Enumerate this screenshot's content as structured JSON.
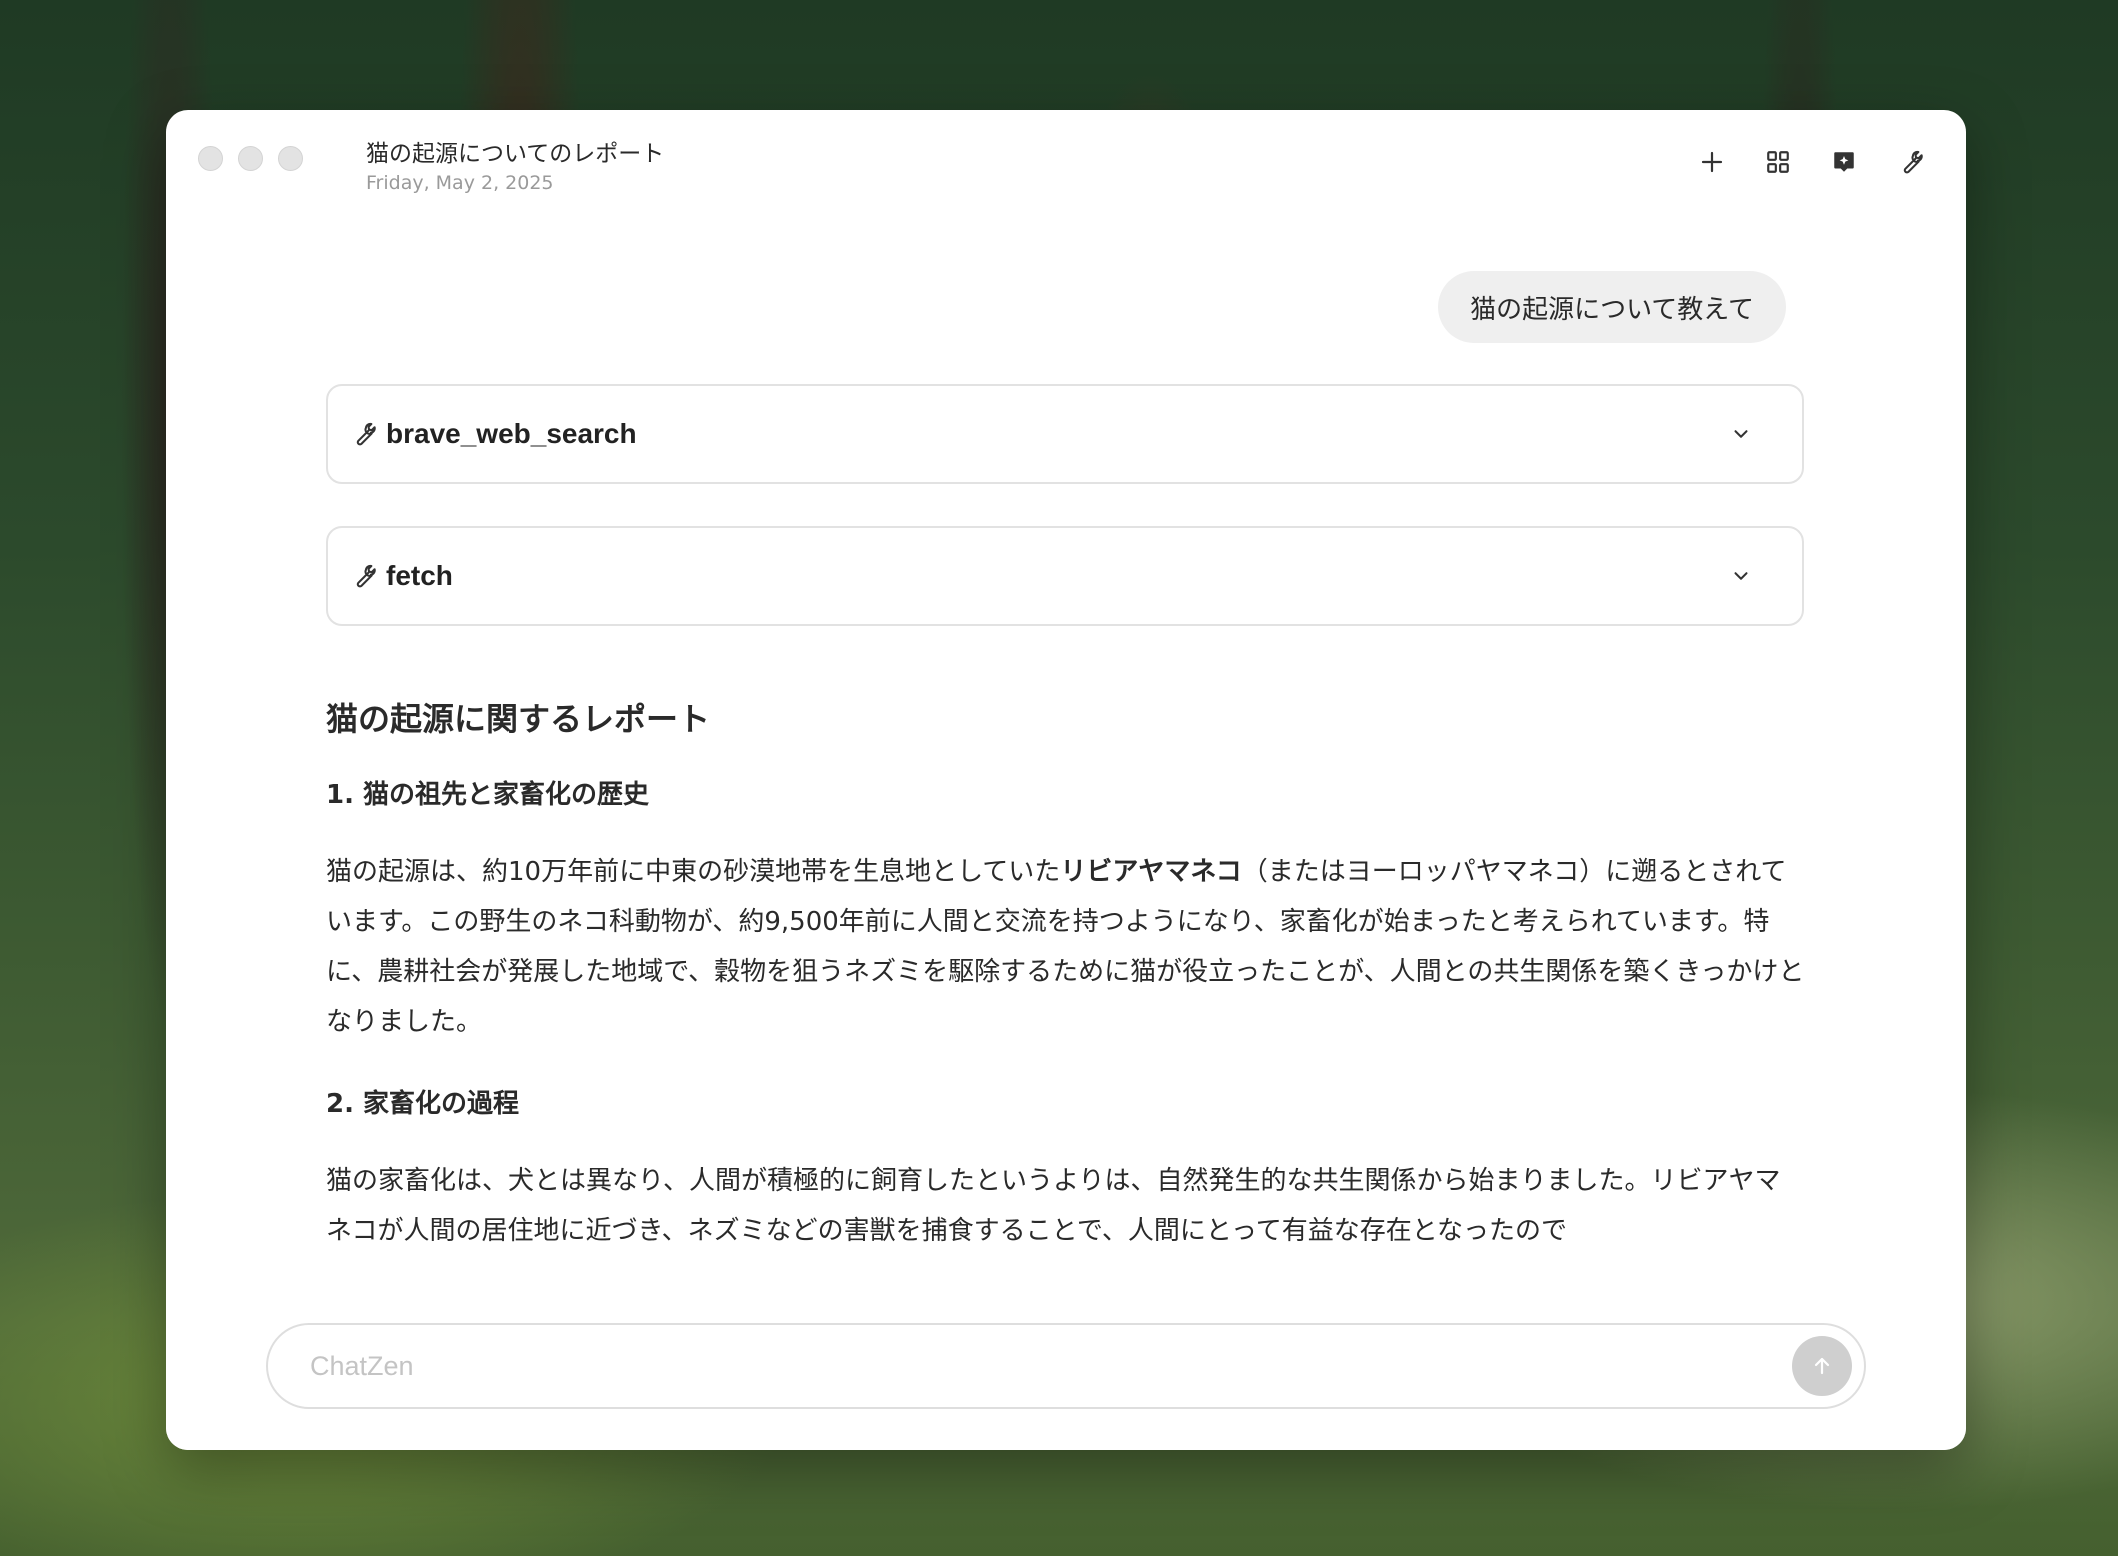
{
  "window": {
    "title": "猫の起源についてのレポート",
    "date": "Friday, May 2, 2025"
  },
  "toolbar": {
    "icons": [
      "plus-icon",
      "grid-icon",
      "sparkle-note-icon",
      "wrench-icon"
    ]
  },
  "chat": {
    "user_message": "猫の起源について教えて",
    "tool_calls": [
      {
        "name": "brave_web_search",
        "icon": "wrench-icon"
      },
      {
        "name": "fetch",
        "icon": "wrench-icon"
      }
    ],
    "report": {
      "title": "猫の起源に関するレポート",
      "section1_heading": "1. 猫の祖先と家畜化の歴史",
      "section1_p_before": "猫の起源は、約10万年前に中東の砂漠地帯を生息地としていた",
      "section1_p_bold": "リビアヤマネコ",
      "section1_p_after": "（またはヨーロッパヤマネコ）に遡るとされています。この野生のネコ科動物が、約9,500年前に人間と交流を持つようになり、家畜化が始まったと考えられています。特に、農耕社会が発展した地域で、穀物を狙うネズミを駆除するために猫が役立ったことが、人間との共生関係を築くきっかけとなりました。",
      "section2_heading": "2. 家畜化の過程",
      "section2_p": "猫の家畜化は、犬とは異なり、人間が積極的に飼育したというよりは、自然発生的な共生関係から始まりました。リビアヤマネコが人間の居住地に近づき、ネズミなどの害獣を捕食することで、人間にとって有益な存在となったので"
    }
  },
  "input": {
    "placeholder": "ChatZen"
  }
}
